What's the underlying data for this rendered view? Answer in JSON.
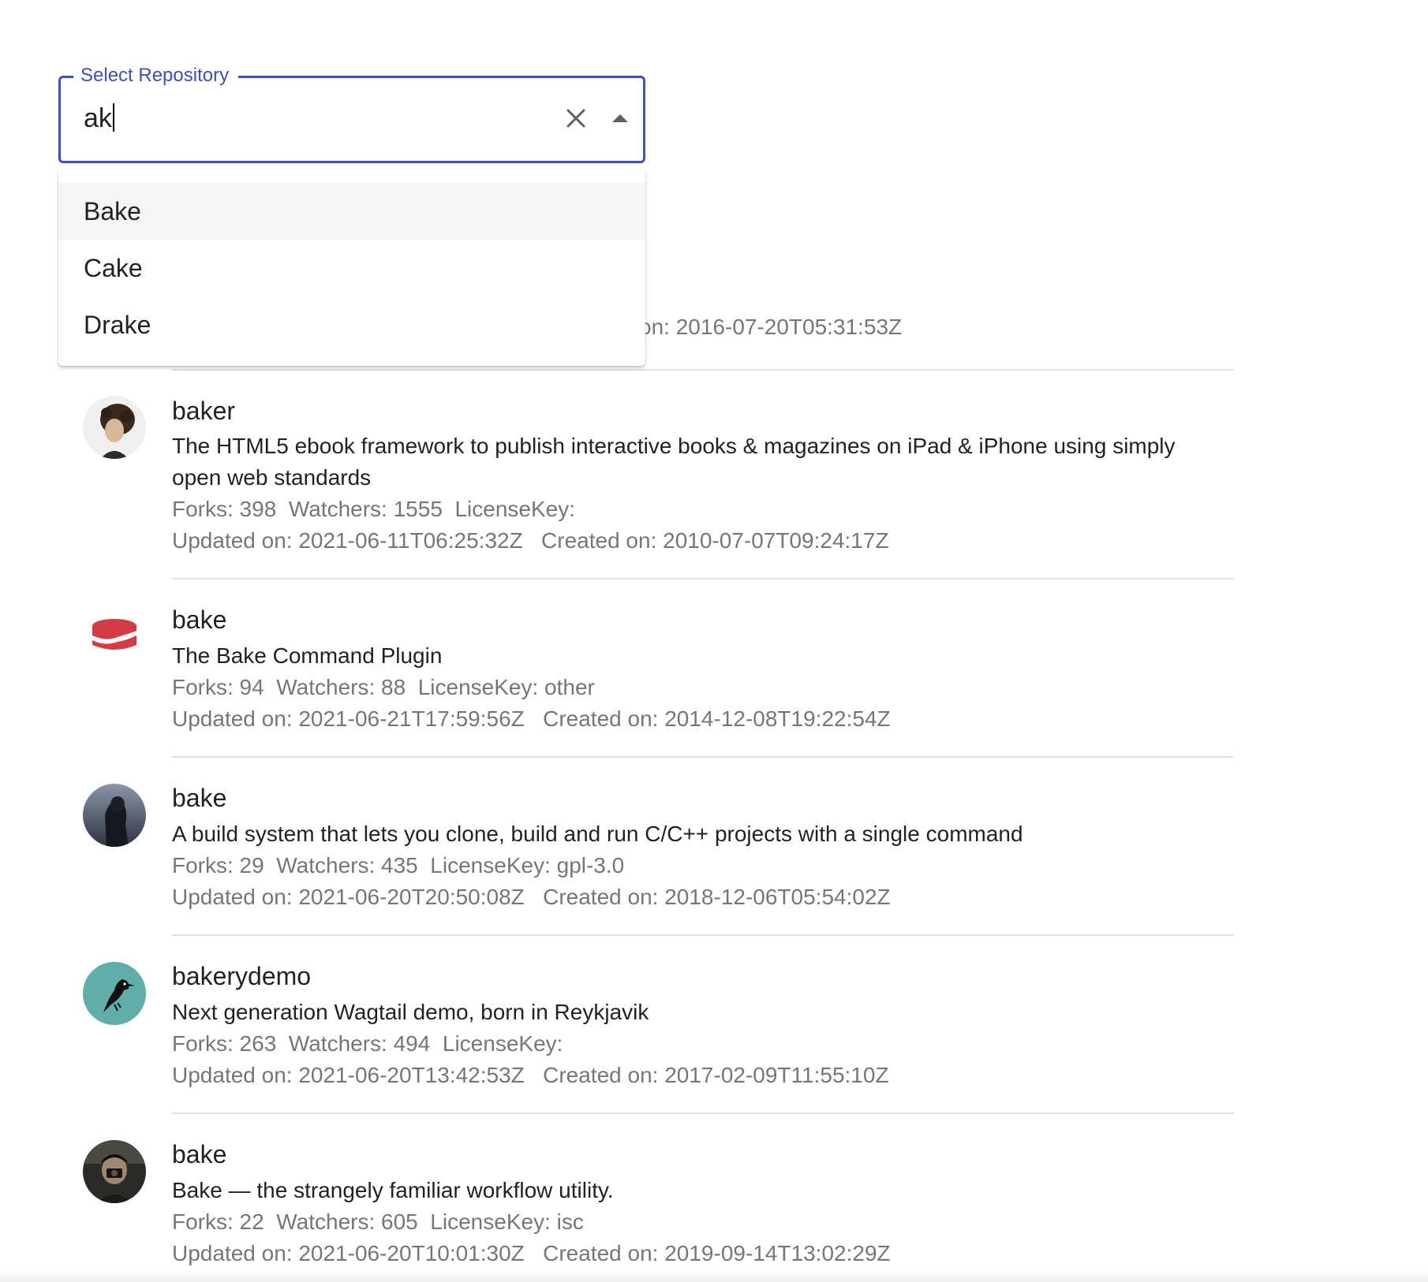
{
  "search": {
    "label": "Select Repository",
    "value": "ak"
  },
  "dropdown": {
    "options": [
      "Bake",
      "Cake",
      "Drake"
    ],
    "focused_index": 0
  },
  "partial_row": {
    "created_fragment": "on: 2016-07-20T05:31:53Z"
  },
  "repos": [
    {
      "name": "baker",
      "description": "The HTML5 ebook framework to publish interactive books & magazines on iPad & iPhone using simply open web standards",
      "meta1": "Forks: 398  Watchers: 1555  LicenseKey: ",
      "meta2": "Updated on: 2021-06-11T06:25:32Z   Created on: 2010-07-07T09:24:17Z",
      "avatar_icon": "curly-hair-person-avatar"
    },
    {
      "name": "bake",
      "description": "The Bake Command Plugin",
      "meta1": "Forks: 94  Watchers: 88  LicenseKey: other",
      "meta2": "Updated on: 2021-06-21T17:59:56Z   Created on: 2014-12-08T19:22:54Z",
      "avatar_icon": "cakephp-logo-avatar"
    },
    {
      "name": "bake",
      "description": "A build system that lets you clone, build and run C/C++ projects with a single command",
      "meta1": "Forks: 29  Watchers: 435  LicenseKey: gpl-3.0",
      "meta2": "Updated on: 2021-06-20T20:50:08Z   Created on: 2018-12-06T05:54:02Z",
      "avatar_icon": "hooded-figure-avatar"
    },
    {
      "name": "bakerydemo",
      "description": "Next generation Wagtail demo, born in Reykjavik",
      "meta1": "Forks: 263  Watchers: 494  LicenseKey: ",
      "meta2": "Updated on: 2021-06-20T13:42:53Z   Created on: 2017-02-09T11:55:10Z",
      "avatar_icon": "wagtail-bird-avatar"
    },
    {
      "name": "bake",
      "description": "Bake — the strangely familiar workflow utility.",
      "meta1": "Forks: 22  Watchers: 605  LicenseKey: isc",
      "meta2": "Updated on: 2021-06-20T10:01:30Z   Created on: 2019-09-14T13:02:29Z",
      "avatar_icon": "photographer-avatar"
    }
  ],
  "colors": {
    "accent": "#3f51b5",
    "divider": "#e0e0e0",
    "secondary_text": "rgba(0,0,0,0.54)",
    "cakephp_red": "#d33c43",
    "wagtail_teal": "#5fafa8"
  }
}
